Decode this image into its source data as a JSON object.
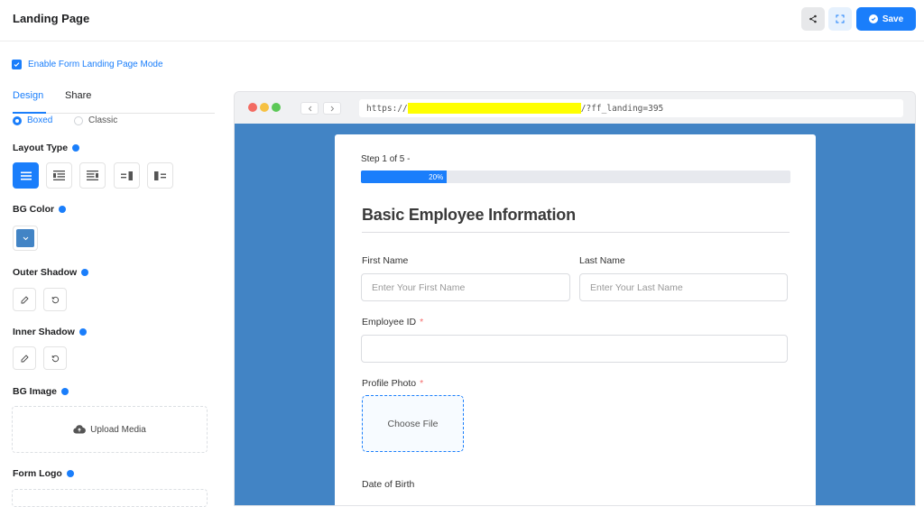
{
  "header": {
    "title": "Landing Page",
    "save_label": "Save",
    "icons": {
      "share": "share-icon",
      "expand": "expand-icon",
      "save": "check-circle-icon"
    }
  },
  "sidebar": {
    "enable_label": "Enable Form Landing Page Mode",
    "enable_checked": true,
    "tabs": [
      {
        "label": "Design",
        "active": true
      },
      {
        "label": "Share",
        "active": false
      }
    ],
    "style_options": [
      {
        "label": "Boxed",
        "selected": true
      },
      {
        "label": "Classic",
        "selected": false
      }
    ],
    "layout_type_label": "Layout Type",
    "layout_options": [
      {
        "name": "default",
        "icon": "layout-centered-icon",
        "active": true
      },
      {
        "name": "media-left",
        "icon": "layout-media-left-icon",
        "active": false
      },
      {
        "name": "media-right",
        "icon": "layout-media-right-icon",
        "active": false
      },
      {
        "name": "split-right",
        "icon": "layout-split-right-icon",
        "active": false
      },
      {
        "name": "split-left",
        "icon": "layout-split-left-icon",
        "active": false
      }
    ],
    "bg_color_label": "BG Color",
    "bg_color_value": "#4284c5",
    "outer_shadow_label": "Outer Shadow",
    "inner_shadow_label": "Inner Shadow",
    "bg_image_label": "BG Image",
    "upload_label": "Upload Media",
    "form_logo_label": "Form Logo"
  },
  "browser": {
    "url_prefix": "https://",
    "url_suffix": "/?ff_landing=395",
    "viewport_color": "#4284c5"
  },
  "form": {
    "step_text": "Step 1 of 5 -",
    "progress_percent": 20,
    "progress_label": "20%",
    "heading": "Basic Employee Information",
    "first_name_label": "First Name",
    "first_name_placeholder": "Enter Your First Name",
    "last_name_label": "Last Name",
    "last_name_placeholder": "Enter Your Last Name",
    "employee_id_label": "Employee ID",
    "required_mark": "*",
    "profile_photo_label": "Profile Photo",
    "choose_file_label": "Choose File",
    "dob_label": "Date of Birth"
  },
  "colors": {
    "accent": "#1a7efb",
    "required": "#f56c6c"
  }
}
